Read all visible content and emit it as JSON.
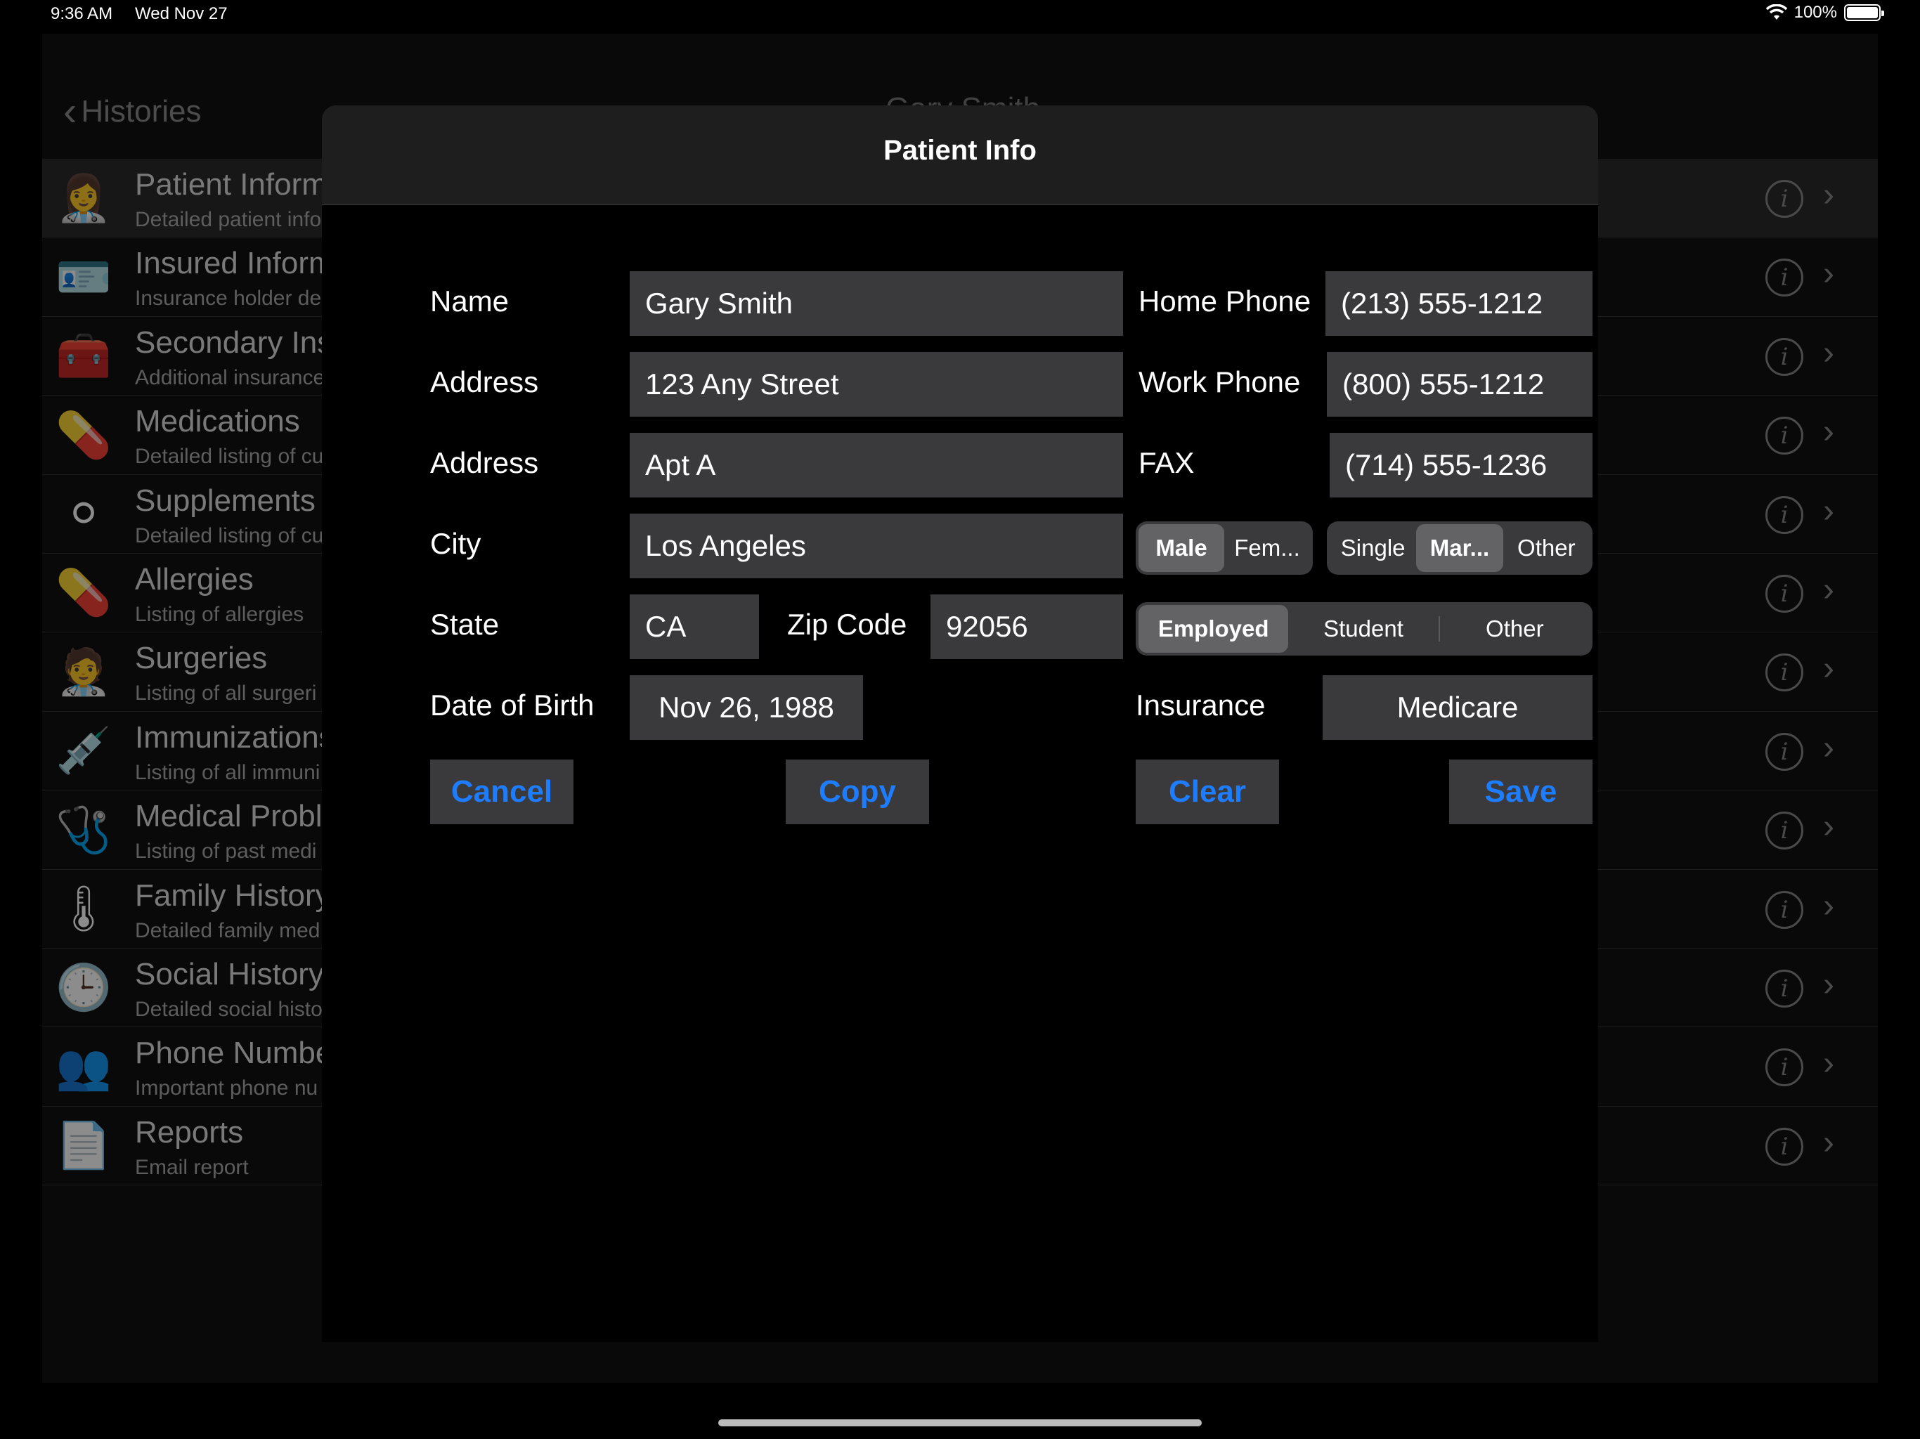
{
  "status_bar": {
    "time": "9:36 AM",
    "date": "Wed Nov 27",
    "battery_text": "100%",
    "icons": [
      "wifi-icon",
      "battery-icon"
    ]
  },
  "background": {
    "back_label": "Histories",
    "nav_title_partial": "Gary Smith",
    "rows": [
      {
        "title": "Patient Inform",
        "subtitle": "Detailed patient info",
        "icon": "nurse-icon"
      },
      {
        "title": "Insured Inform",
        "subtitle": "Insurance holder de",
        "icon": "insurance-card-icon"
      },
      {
        "title": "Secondary Ins",
        "subtitle": "Additional insurance",
        "icon": "first-aid-kit-icon"
      },
      {
        "title": "Medications",
        "subtitle": "Detailed listing of cu",
        "icon": "capsules-icon"
      },
      {
        "title": "Supplements",
        "subtitle": "Detailed listing of cu",
        "icon": "tablets-icon"
      },
      {
        "title": "Allergies",
        "subtitle": "Listing of allergies",
        "icon": "pills-icon"
      },
      {
        "title": "Surgeries",
        "subtitle": "Listing of all surgeri",
        "icon": "surgeon-icon"
      },
      {
        "title": "Immunizations",
        "subtitle": "Listing of all immuni",
        "icon": "syringe-icon"
      },
      {
        "title": "Medical Probl",
        "subtitle": "Listing of past medi",
        "icon": "stethoscope-icon"
      },
      {
        "title": "Family History",
        "subtitle": "Detailed family med",
        "icon": "thermometer-icon"
      },
      {
        "title": "Social History",
        "subtitle": "Detailed social histo",
        "icon": "clock-icon"
      },
      {
        "title": "Phone Numbe",
        "subtitle": "Important phone nu",
        "icon": "contacts-icon"
      },
      {
        "title": "Reports",
        "subtitle": "Email report",
        "icon": "report-icon"
      }
    ]
  },
  "modal": {
    "title": "Patient Info",
    "labels": {
      "name": "Name",
      "address1": "Address",
      "address2": "Address",
      "city": "City",
      "state": "State",
      "zip": "Zip Code",
      "dob": "Date of Birth",
      "home_phone": "Home Phone",
      "work_phone": "Work Phone",
      "fax": "FAX",
      "insurance": "Insurance"
    },
    "values": {
      "name": "Gary Smith",
      "address1": "123 Any Street",
      "address2": "Apt A",
      "city": "Los Angeles",
      "state": "CA",
      "zip": "92056",
      "dob": "Nov 26, 1988",
      "home_phone": "(213) 555-1212",
      "work_phone": "(800) 555-1212",
      "fax": "(714) 555-1236",
      "insurance": "Medicare"
    },
    "gender_segment": {
      "options": [
        "Male",
        "Fem..."
      ],
      "selected": "Male"
    },
    "marital_segment": {
      "options": [
        "Single",
        "Mar...",
        "Other"
      ],
      "selected": "Mar..."
    },
    "employment_segment": {
      "options": [
        "Employed",
        "Student",
        "Other"
      ],
      "selected": "Employed"
    },
    "buttons": {
      "cancel": "Cancel",
      "copy": "Copy",
      "clear": "Clear",
      "save": "Save"
    },
    "accent_color": "#1e7cff"
  }
}
